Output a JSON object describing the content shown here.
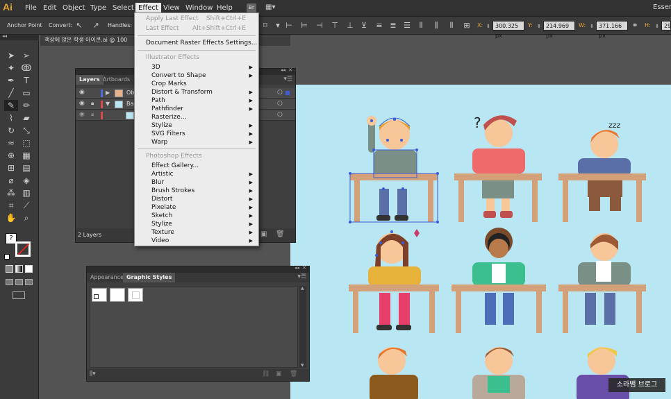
{
  "app": {
    "logo": "Ai",
    "workspace": "Essent"
  },
  "menubar": {
    "items": [
      "File",
      "Edit",
      "Object",
      "Type",
      "Select",
      "Effect",
      "View",
      "Window",
      "Help"
    ],
    "bridge": "Br"
  },
  "controlbar": {
    "anchor_point": "Anchor Point",
    "convert": "Convert:",
    "handles": "Handles:",
    "x_label": "X:",
    "x_value": "300.325 px",
    "y_label": "Y:",
    "y_value": "214.969 px",
    "w_label": "W:",
    "w_value": "371.166 px",
    "h_label": "H:",
    "h_value": "29"
  },
  "document": {
    "tab_title": "책상에 앉은 학생 아이콘.ai @ 100"
  },
  "layers_panel": {
    "tabs": [
      "Layers",
      "Artboards"
    ],
    "rows": [
      {
        "name": "Obj"
      },
      {
        "name": "Bac"
      },
      {
        "name": ""
      }
    ],
    "footer": "2 Layers"
  },
  "styles_panel": {
    "tabs": [
      "Appearance",
      "Graphic Styles"
    ]
  },
  "effect_menu": {
    "apply_last": "Apply Last Effect",
    "apply_last_shortcut": "Shift+Ctrl+E",
    "last_effect": "Last Effect",
    "last_effect_shortcut": "Alt+Shift+Ctrl+E",
    "raster_settings": "Document Raster Effects Settings...",
    "illustrator_header": "Illustrator Effects",
    "illustrator_items": [
      "3D",
      "Convert to Shape",
      "Crop Marks",
      "Distort & Transform",
      "Path",
      "Pathfinder",
      "Rasterize...",
      "Stylize",
      "SVG Filters",
      "Warp"
    ],
    "photoshop_header": "Photoshop Effects",
    "photoshop_items": [
      "Effect Gallery...",
      "Artistic",
      "Blur",
      "Brush Strokes",
      "Distort",
      "Pixelate",
      "Sketch",
      "Stylize",
      "Texture",
      "Video"
    ]
  },
  "artboard": {
    "annot_question": "?",
    "annot_zzz": "zzz"
  },
  "watermark": "소라뱀 브로그",
  "colors": {
    "artboard_bg": "#b8e6f3",
    "desk": "#d4a07a",
    "accent_orange": "#e8a433"
  }
}
